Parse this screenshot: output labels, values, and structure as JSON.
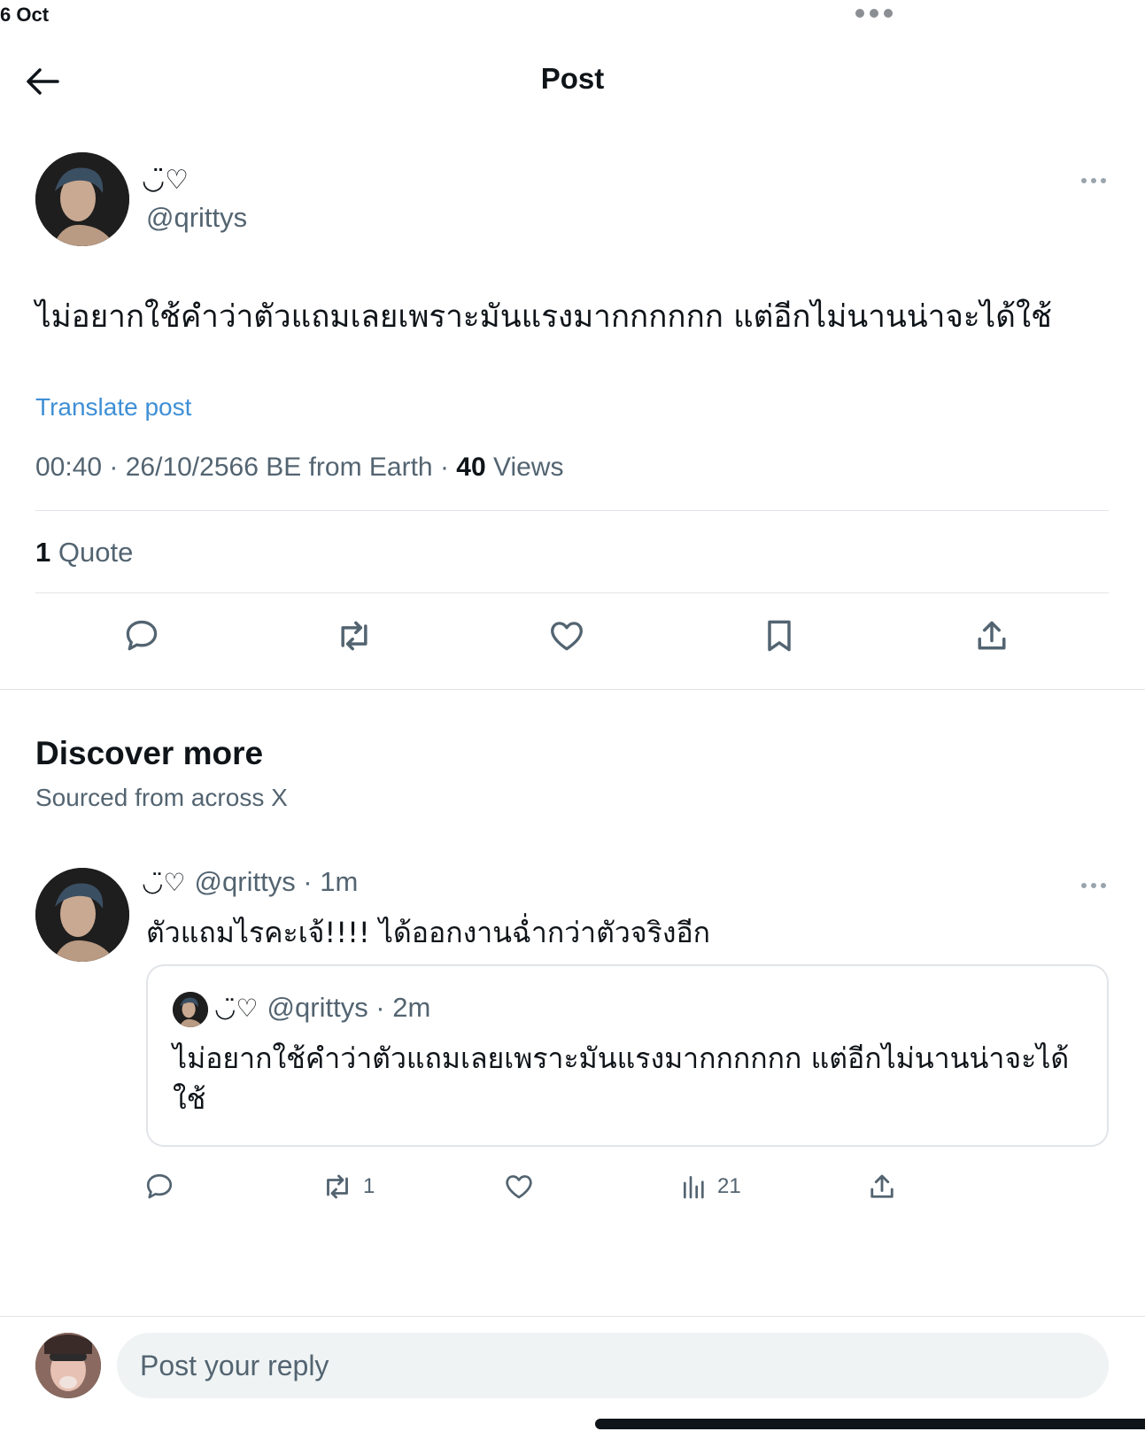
{
  "status_bar": {
    "date": "6 Oct"
  },
  "header": {
    "title": "Post",
    "back_icon": "arrow-left-icon"
  },
  "post": {
    "display_name": "◡̈♡",
    "handle": "@qrittys",
    "text": "ไม่อยากใช้คำว่าตัวแถมเลยเพราะมันแรงมากกกกกก แต่อีกไม่นานน่าจะได้ใช้",
    "translate_label": "Translate post",
    "meta_prefix": "00:40 · 26/10/2566 BE from Earth · ",
    "views_count": "40",
    "views_label": " Views",
    "quote_count": "1",
    "quote_label": " Quote",
    "actions": [
      "reply-icon",
      "repost-icon",
      "like-icon",
      "bookmark-icon",
      "share-icon"
    ]
  },
  "discover": {
    "title": "Discover more",
    "subtitle": "Sourced from across X"
  },
  "reply": {
    "display_name": "◡̈♡",
    "handle_time": "@qrittys · 1m",
    "text": "ตัวแถมไรคะเจ้!!!! ได้ออกงานฉ่ำกว่าตัวจริงอีก",
    "quoted": {
      "display_name": "◡̈♡",
      "handle_time": "@qrittys · 2m",
      "text": "ไม่อยากใช้คำว่าตัวแถมเลยเพราะมันแรงมากกกกกก แต่อีกไม่นานน่าจะได้ใช้"
    },
    "stats": {
      "reposts": "1",
      "views": "21"
    }
  },
  "composer": {
    "placeholder": "Post your reply"
  },
  "colors": {
    "link": "#3e8fd6",
    "secondary": "#536471",
    "divider": "#e1e4e8",
    "input_bg": "#eff3f4"
  }
}
